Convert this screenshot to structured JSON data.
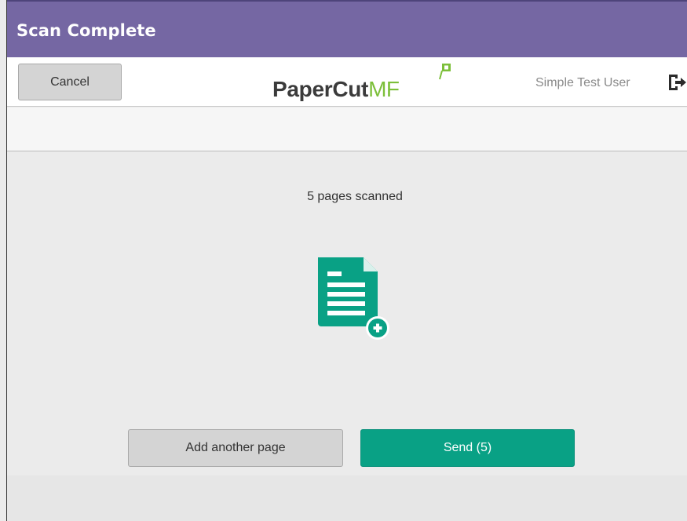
{
  "title_bar": {
    "title": "Scan Complete",
    "background_color": "#7567a3"
  },
  "header": {
    "cancel_label": "Cancel",
    "logo": {
      "brand_primary": "PaperCut",
      "brand_secondary": "MF",
      "primary_color": "#3b3b3b",
      "accent_color": "#7cbf3a"
    },
    "user_name": "Simple Test User",
    "logout_icon": "logout-icon"
  },
  "main": {
    "status_text": "5 pages scanned",
    "document_icon": "document-add-icon",
    "icon_color": "#09a185",
    "add_page_label": "Add another page",
    "send_label": "Send (5)",
    "send_color": "#09a185"
  }
}
